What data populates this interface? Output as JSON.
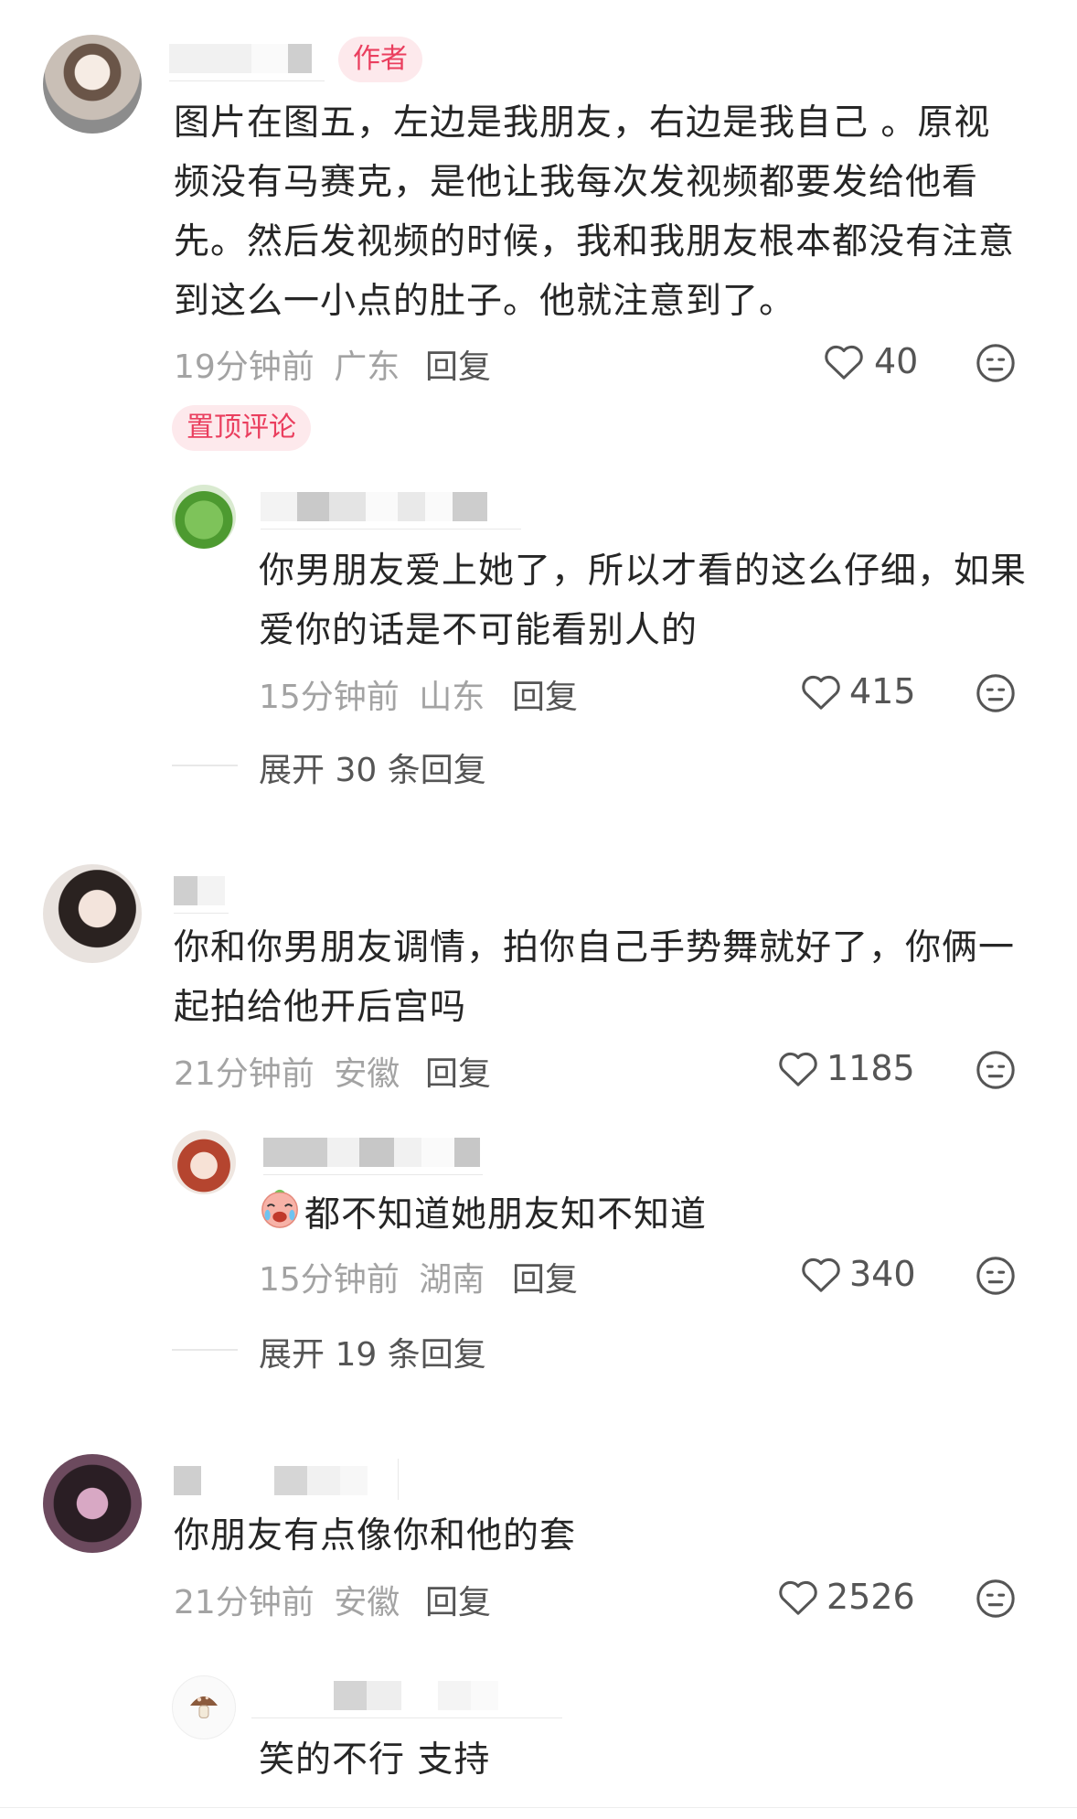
{
  "colors": {
    "accent": "#ea3e5e",
    "badge_bg": "#fde9ec",
    "meta": "#a3a3a3"
  },
  "icons": {
    "like": "heart-outline-icon",
    "dislike": "neutral-face-icon"
  },
  "comments": [
    {
      "badge": "作者",
      "text": "图片在图五，左边是我朋友，右边是我自己 。原视频没有马赛克，是他让我每次发视频都要发给他看先。然后发视频的时候，我和我朋友根本都没有注意到这么一小点的肚子。他就注意到了。",
      "time": "19分钟前",
      "location": "广东",
      "reply_label": "回复",
      "likes": "40",
      "pinned_label": "置顶评论",
      "reply": {
        "text": "你男朋友爱上她了，所以才看的这么仔细，如果爱你的话是不可能看别人的",
        "time": "15分钟前",
        "location": "山东",
        "reply_label": "回复",
        "likes": "415"
      },
      "expand_label": "展开 30 条回复"
    },
    {
      "text": "你和你男朋友调情，拍你自己手势舞就好了，你俩一起拍给他开后宫吗",
      "time": "21分钟前",
      "location": "安徽",
      "reply_label": "回复",
      "likes": "1185",
      "reply": {
        "emoji": "crying-face-emoji",
        "text": "都不知道她朋友知不知道",
        "time": "15分钟前",
        "location": "湖南",
        "reply_label": "回复",
        "likes": "340"
      },
      "expand_label": "展开 19 条回复"
    },
    {
      "text": "你朋友有点像你和他的套",
      "time": "21分钟前",
      "location": "安徽",
      "reply_label": "回复",
      "likes": "2526",
      "reply": {
        "text": "笑的不行 支持"
      }
    }
  ]
}
